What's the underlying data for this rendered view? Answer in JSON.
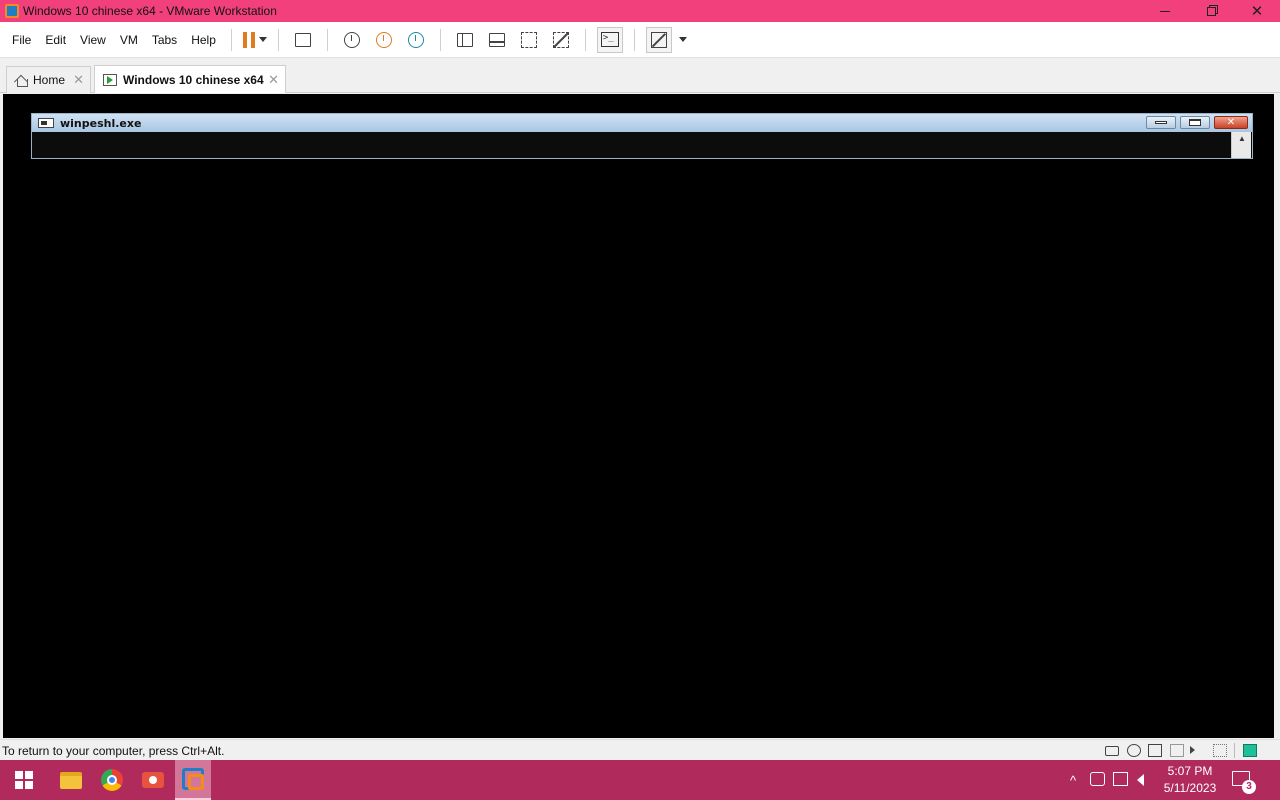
{
  "window": {
    "title": "Windows 10 chinese  x64 - VMware Workstation",
    "min_icon": "minimize-icon",
    "max_icon": "restore-icon",
    "close_icon": "close-icon",
    "close_glyph": "✕"
  },
  "menu": {
    "items": [
      "File",
      "Edit",
      "View",
      "VM",
      "Tabs",
      "Help"
    ]
  },
  "toolbar": {
    "icons": [
      "pause-icon",
      "send-ctrl-alt-del-icon",
      "snapshot-icon",
      "revert-snapshot-icon",
      "snapshot-manager-icon",
      "show-library-icon",
      "thumbnail-bar-icon",
      "full-screen-icon",
      "unity-icon",
      "console-view-icon",
      "stretch-guest-icon"
    ],
    "console_glyph": ">_"
  },
  "tabs": [
    {
      "label": "Home",
      "close": "✕"
    },
    {
      "label": "Windows 10 chinese  x64",
      "close": "✕"
    }
  ],
  "guest": {
    "window_title": "winpeshl.exe",
    "close_glyph": "✕",
    "scroll_up": "▲",
    "background": "#000000"
  },
  "status": {
    "message": "To return to your computer, press Ctrl+Alt.",
    "devices": [
      "hard-disk-icon",
      "cd-dvd-icon",
      "network-adapter-icon",
      "printer-icon",
      "sound-card-icon",
      "display-icon",
      "message-log-icon"
    ]
  },
  "taskbar": {
    "apps": [
      "windows-start-icon",
      "file-explorer-icon",
      "chrome-icon",
      "screen-recorder-icon",
      "vmware-workstation-icon"
    ],
    "tray_chevron": "^",
    "clock_time": "5:07 PM",
    "clock_date": "5/11/2023",
    "notification_count": "3",
    "accent": "#b02a5c"
  },
  "colors": {
    "titlebar": "#f2407c",
    "pause": "#e07b20"
  }
}
